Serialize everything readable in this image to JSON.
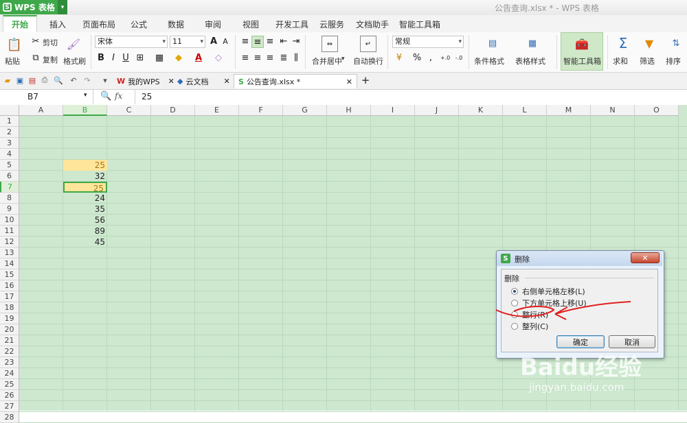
{
  "app": {
    "logo_text": "WPS 表格",
    "window_title": "公告查询.xlsx * - WPS 表格"
  },
  "tabs": [
    "开始",
    "插入",
    "页面布局",
    "公式",
    "数据",
    "审阅",
    "视图",
    "开发工具",
    "云服务",
    "文档助手",
    "智能工具箱"
  ],
  "ribbon": {
    "paste": "粘贴",
    "cut": "剪切",
    "copy": "复制",
    "format_painter": "格式刷",
    "font_name": "宋体",
    "font_size": "11",
    "merge_center": "合并居中",
    "wrap_text": "自动换行",
    "number_format": "常规",
    "conditional_format": "条件格式",
    "table_style": "表格样式",
    "smart_toolbox": "智能工具箱",
    "sum": "求和",
    "filter": "筛选",
    "sort": "排序"
  },
  "doc_tabs": [
    "我的WPS",
    "云文档",
    "公告查询.xlsx *"
  ],
  "formula_bar": {
    "name_box": "B7",
    "fx": "fx",
    "value": "25"
  },
  "columns": [
    "A",
    "B",
    "C",
    "D",
    "E",
    "F",
    "G",
    "H",
    "I",
    "J",
    "K",
    "L",
    "M",
    "N",
    "O"
  ],
  "rows": [
    "1",
    "2",
    "3",
    "4",
    "5",
    "6",
    "7",
    "8",
    "9",
    "10",
    "11",
    "12",
    "13",
    "14",
    "15",
    "16",
    "17",
    "18",
    "19",
    "20",
    "21",
    "22",
    "23",
    "24",
    "25",
    "26",
    "27",
    "28"
  ],
  "cells_b": [
    {
      "row": "5",
      "value": "25"
    },
    {
      "row": "6",
      "value": "32"
    },
    {
      "row": "7",
      "value": "25"
    },
    {
      "row": "8",
      "value": "24"
    },
    {
      "row": "9",
      "value": "35"
    },
    {
      "row": "10",
      "value": "56"
    },
    {
      "row": "11",
      "value": "89"
    },
    {
      "row": "12",
      "value": "45"
    }
  ],
  "dialog": {
    "title": "删除",
    "group_label": "删除",
    "options": [
      "右侧单元格左移(L)",
      "下方单元格上移(U)",
      "整行(R)",
      "整列(C)"
    ],
    "selected_index": 0,
    "ok": "确定",
    "cancel": "取消"
  },
  "watermark": {
    "main": "Baidu经验",
    "sub": "jingyan.baidu.com"
  },
  "colors": {
    "accent": "#3fa84a",
    "grid_bg": "#cde8cf",
    "highlight": "#ffe59a",
    "annotation": "#e01e1e"
  }
}
